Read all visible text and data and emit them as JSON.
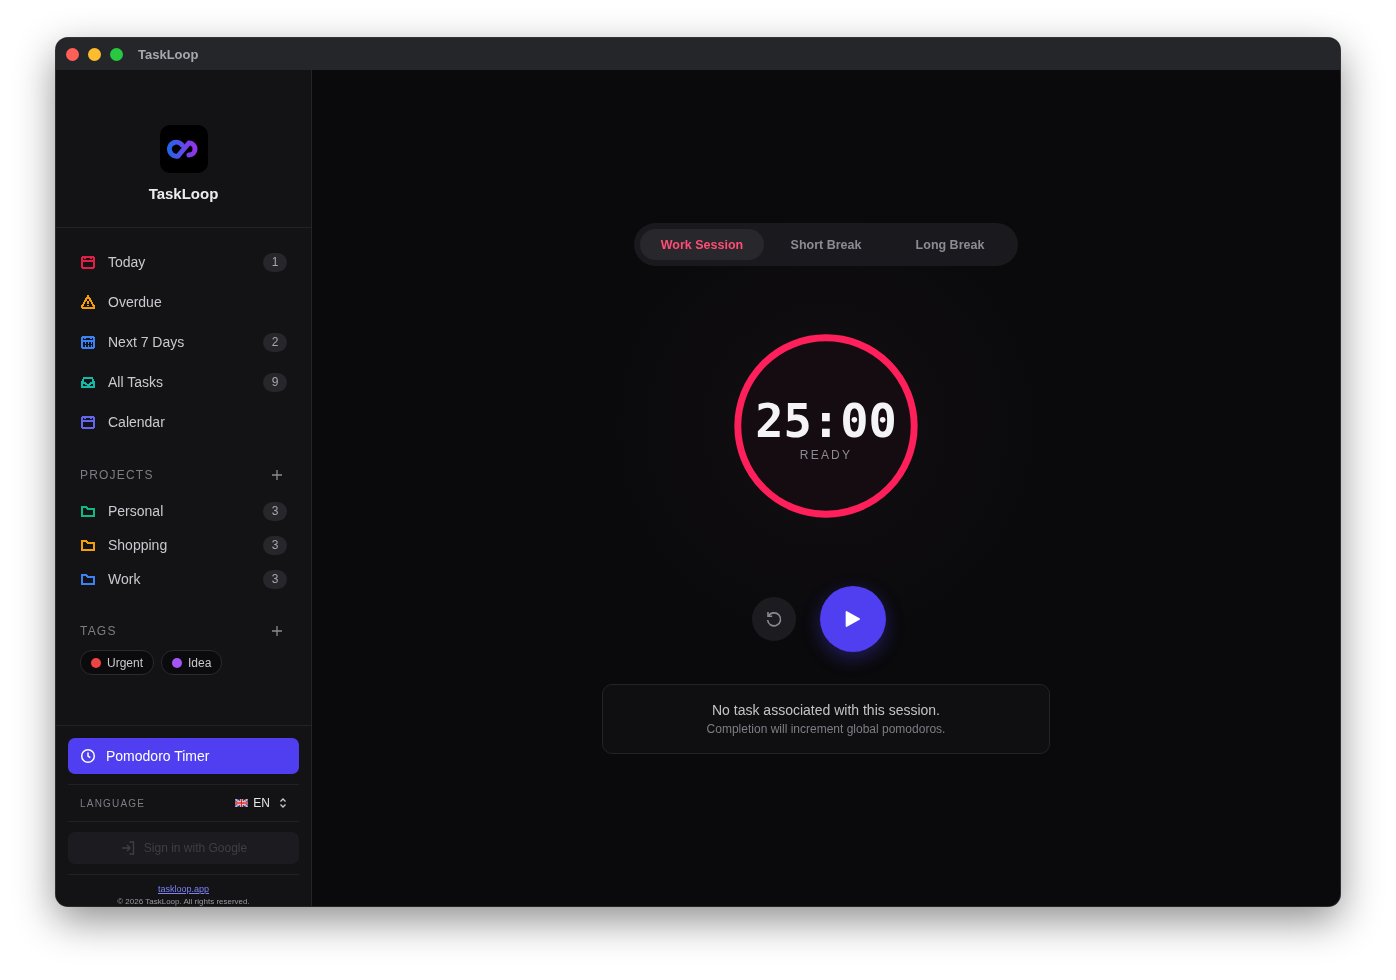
{
  "window": {
    "title": "TaskLoop"
  },
  "sidebar": {
    "app_name": "TaskLoop",
    "nav": [
      {
        "label": "Today",
        "count": "1",
        "kind": "calendar",
        "color": "#e11d48",
        "selected": false
      },
      {
        "label": "Overdue",
        "kind": "warning",
        "color": "#f59e0b",
        "selected": false
      },
      {
        "label": "Next 7 Days",
        "count": "2",
        "kind": "calendar-grid",
        "color": "#3b82f6",
        "selected": false
      },
      {
        "label": "All Tasks",
        "count": "9",
        "kind": "inbox",
        "color": "#14b8a6",
        "selected": false
      },
      {
        "label": "Calendar",
        "kind": "calendar",
        "color": "#6366f1",
        "selected": false
      }
    ],
    "projects": {
      "title": "PROJECTS",
      "items": [
        {
          "label": "Personal",
          "count": "3",
          "color": "#10b981"
        },
        {
          "label": "Shopping",
          "count": "3",
          "color": "#f59e0b"
        },
        {
          "label": "Work",
          "count": "3",
          "color": "#3b82f6"
        }
      ]
    },
    "tags": {
      "title": "TAGS",
      "items": [
        {
          "label": "Urgent",
          "color": "#ef4444"
        },
        {
          "label": "Idea",
          "color": "#a855f7"
        }
      ]
    },
    "pomodoro": {
      "label": "Pomodoro Timer",
      "selected": true
    },
    "language": {
      "label": "LANGUAGE",
      "value": "EN"
    },
    "sign_in": {
      "label": "Sign in with Google",
      "disabled": true
    },
    "link": "taskloop.app",
    "copyright": "© 2026 TaskLoop. All rights reserved."
  },
  "timer": {
    "modes": [
      {
        "label": "Work Session",
        "selected": true
      },
      {
        "label": "Short Break",
        "selected": false
      },
      {
        "label": "Long Break",
        "selected": false
      }
    ],
    "time": "25:00",
    "status": "READY",
    "level": 1,
    "note": {
      "title": "No task associated with this session.",
      "subtitle": "Completion will increment global pomodoros."
    }
  }
}
